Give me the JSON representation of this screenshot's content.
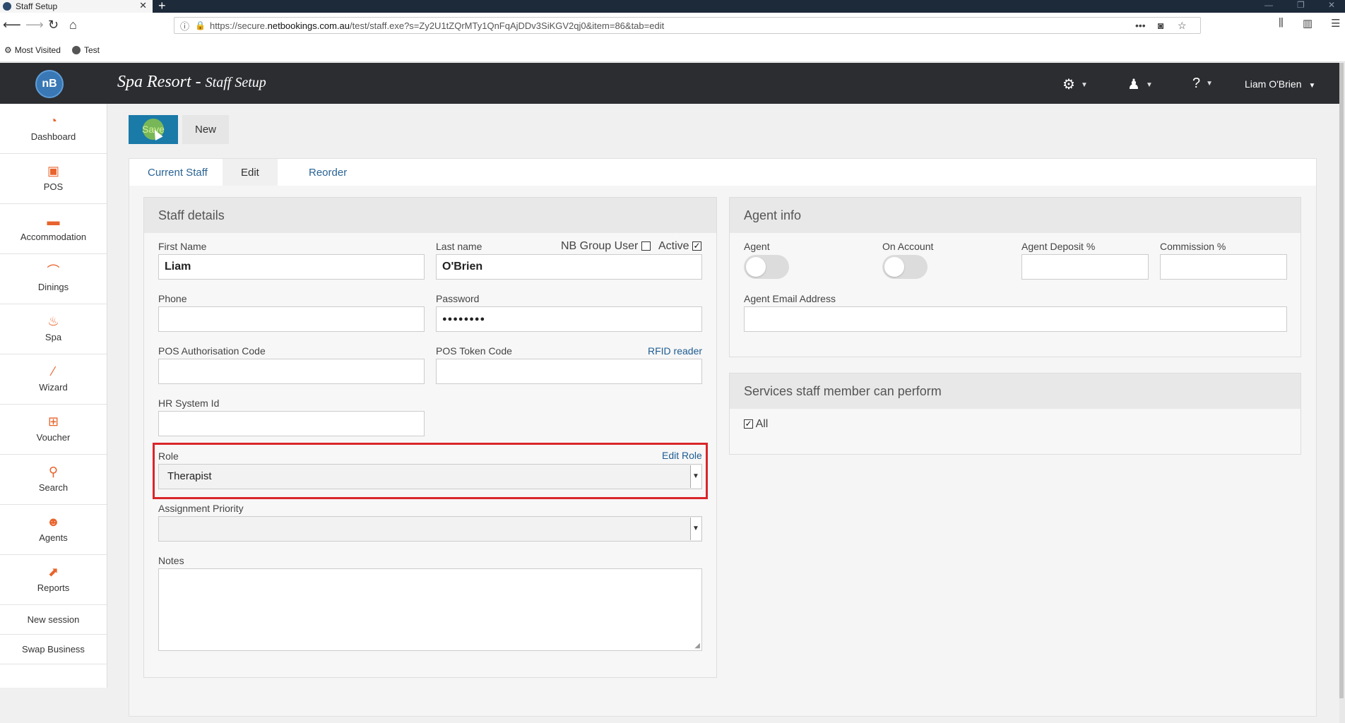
{
  "browser": {
    "tab_title": "Staff Setup",
    "url_prefix": "https://secure.",
    "url_domain": "netbookings.com.au",
    "url_rest": "/test/staff.exe?s=Zy2U1tZQrMTy1QnFqAjDDv3SiKGV2qj0&item=86&tab=edit",
    "bookmarks": [
      "Most Visited",
      "Test"
    ]
  },
  "header": {
    "logo": "nB",
    "business": "Spa Resort",
    "separator": " - ",
    "page": "Staff Setup",
    "user": "Liam O'Brien"
  },
  "sidebar": {
    "items": [
      {
        "label": "Dashboard",
        "icon": "dashboard-icon"
      },
      {
        "label": "POS",
        "icon": "pos-icon"
      },
      {
        "label": "Accommodation",
        "icon": "bed-icon"
      },
      {
        "label": "Dinings",
        "icon": "dining-icon"
      },
      {
        "label": "Spa",
        "icon": "spa-icon"
      },
      {
        "label": "Wizard",
        "icon": "wand-icon"
      },
      {
        "label": "Voucher",
        "icon": "gift-icon"
      },
      {
        "label": "Search",
        "icon": "search-icon"
      },
      {
        "label": "Agents",
        "icon": "agent-icon"
      },
      {
        "label": "Reports",
        "icon": "chart-icon"
      }
    ],
    "links": [
      "New session",
      "Swap Business"
    ]
  },
  "toolbar": {
    "save": "Save",
    "new": "New"
  },
  "tabs": [
    "Current Staff",
    "Edit",
    "Reorder"
  ],
  "staff": {
    "title": "Staff details",
    "first_name_label": "First Name",
    "first_name": "Liam",
    "last_name_label": "Last name",
    "last_name": "O'Brien",
    "nb_group_label": "NB Group User",
    "nb_group_checked": false,
    "active_label": "Active",
    "active_checked": true,
    "phone_label": "Phone",
    "phone": "",
    "password_label": "Password",
    "password": "●●●●●●●●",
    "pos_auth_label": "POS Authorisation Code",
    "pos_token_label": "POS Token Code",
    "rfid_link": "RFID reader",
    "hr_label": "HR System Id",
    "role_label": "Role",
    "edit_role_link": "Edit Role",
    "role_value": "Therapist",
    "priority_label": "Assignment Priority",
    "priority_value": "",
    "notes_label": "Notes"
  },
  "agent": {
    "title": "Agent info",
    "agent_label": "Agent",
    "agent_on": false,
    "on_account_label": "On Account",
    "on_account_on": false,
    "deposit_label": "Agent Deposit %",
    "commission_label": "Commission %",
    "email_label": "Agent Email Address"
  },
  "services": {
    "title": "Services staff member can perform",
    "all_label": "All",
    "all_checked": true
  }
}
